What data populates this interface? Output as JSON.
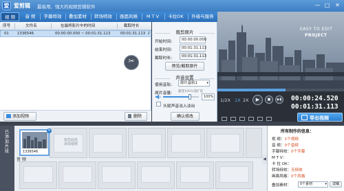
{
  "window": {
    "app_name": "爱剪辑",
    "slogan": "最易用、强大的视频剪辑软件",
    "logo_char": "爱",
    "controls": [
      "—",
      "□",
      "✕"
    ]
  },
  "tabs": [
    {
      "label": "视 频",
      "active": true
    },
    {
      "label": "音 频",
      "active": false
    },
    {
      "label": "字幕特效",
      "active": false
    },
    {
      "label": "叠加素材",
      "active": false
    },
    {
      "label": "转场特效",
      "active": false
    },
    {
      "label": "画面风格",
      "active": false
    },
    {
      "label": "M T V",
      "active": false
    },
    {
      "label": "卡拉OK",
      "active": false
    },
    {
      "label": "升级与服务",
      "active": false
    }
  ],
  "clip_table": {
    "headers": [
      "序号",
      "文件名",
      "在最终影片中的时间",
      "截取时长"
    ],
    "rows": [
      {
        "index": "01",
        "filename": "1336546",
        "time_range": "00:00:00.000 ~ 00:01:31.113",
        "duration": "00:01:31.113"
      }
    ],
    "add_button": "添加视频",
    "delete_button": "删除"
  },
  "trim_panel": {
    "title": "裁剪原片",
    "start_label": "开始时间:",
    "start_value": "00:00:00.000",
    "end_label": "结束时间:",
    "end_value": "00:01:31.113",
    "duration_label": "截取时长:",
    "duration_value": "00:01:31.113",
    "preview_button": "预览/截取原片",
    "audio_title": "声音设置",
    "track_label": "使用音轨:",
    "track_value": "原片音轨1",
    "volume_label": "原片音量:",
    "volume_hint": "最佳100%或扩音",
    "volume_value": "100%",
    "volume_level": 0.75,
    "fade_label": "头尾声音淡入淡出",
    "confirm_button": "确认修改"
  },
  "preview": {
    "line1": "EASY TO EDIT",
    "line2": "PROJECT"
  },
  "player": {
    "speeds": [
      "1/2X",
      "1X",
      "2X"
    ],
    "progress": 0.54,
    "current_time": "00:00:24.520",
    "total_time": "00:01:31.113",
    "export_label": "导出视频"
  },
  "timeline": {
    "side_label": "已添加片段",
    "clip_label": "1336546",
    "placeholder": "双击此处\n添加视频",
    "audio_label": "音 频"
  },
  "info_panel": {
    "title": "所有制作的信息：",
    "rows": [
      {
        "key": "视    频：",
        "value": "1个视频"
      },
      {
        "key": "音    频：",
        "value": "0个音频"
      },
      {
        "key": "字幕特效：",
        "value": "0个字幕"
      },
      {
        "key": "M  T  V：",
        "value": ""
      },
      {
        "key": "卡 拉 OK：",
        "value": ""
      },
      {
        "key": "转场特效：",
        "value": "无特效"
      },
      {
        "key": "画面风格：",
        "value": "0个风格"
      },
      {
        "key": "叠加素材：",
        "value": "0个素材"
      }
    ],
    "detail_button": "详细"
  },
  "colors": {
    "accent": "#2d7fcf",
    "titlebar": "#3d7ec4",
    "info_value": "#d44b1e"
  }
}
